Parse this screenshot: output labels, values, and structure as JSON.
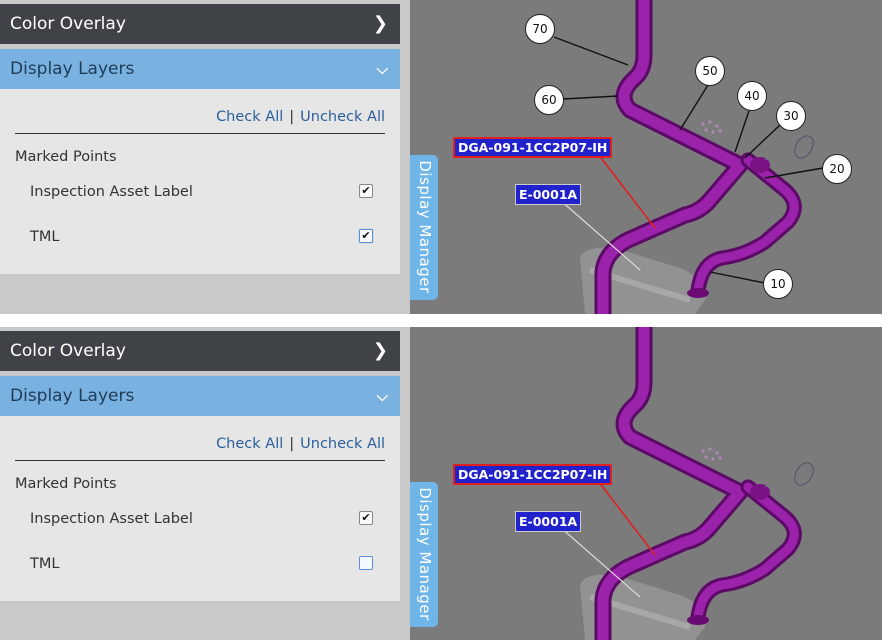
{
  "panels": [
    {
      "color_overlay": "Color Overlay",
      "display_layers": "Display Layers",
      "check_all": "Check All",
      "uncheck_all": "Uncheck All",
      "group_label": "Marked Points",
      "layers": [
        {
          "label": "Inspection Asset Label",
          "checked": true
        },
        {
          "label": "TML",
          "checked": true
        }
      ],
      "tab_label": "Display Manager",
      "line_label": "DGA-091-1CC2P07-IH",
      "equipment_label": "E-0001A",
      "tml_markers": [
        "70",
        "60",
        "50",
        "40",
        "30",
        "20",
        "10"
      ]
    },
    {
      "color_overlay": "Color Overlay",
      "display_layers": "Display Layers",
      "check_all": "Check All",
      "uncheck_all": "Uncheck All",
      "group_label": "Marked Points",
      "layers": [
        {
          "label": "Inspection Asset Label",
          "checked": true
        },
        {
          "label": "TML",
          "checked": false
        }
      ],
      "tab_label": "Display Manager",
      "line_label": "DGA-091-1CC2P07-IH",
      "equipment_label": "E-0001A"
    }
  ],
  "icons": {
    "header_collapsed": "chevron-right-icon",
    "header_expanded": "chevron-down-icon",
    "checked": "checkmark-icon"
  },
  "colors": {
    "header_dark": "#3f4347",
    "header_blue": "#79b2e0",
    "tab_blue": "#6fb5e8",
    "pipe_purple": "#8e1a9a",
    "label_bg": "#2222cc",
    "line_label_border": "#e02020"
  }
}
